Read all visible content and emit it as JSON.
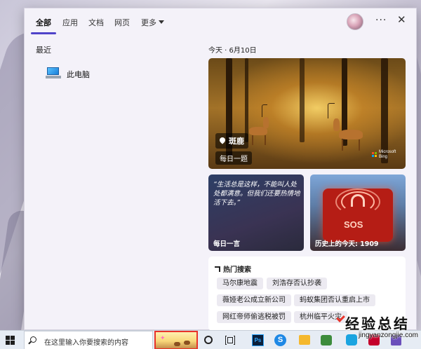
{
  "tabs": [
    {
      "label": "全部",
      "active": true
    },
    {
      "label": "应用",
      "active": false
    },
    {
      "label": "文档",
      "active": false
    },
    {
      "label": "网页",
      "active": false
    },
    {
      "label": "更多",
      "active": false
    }
  ],
  "header_icons": {
    "avatar": "user-avatar",
    "more": "···",
    "close": "✕"
  },
  "recent": {
    "title": "最近",
    "items": [
      {
        "label": "此电脑",
        "icon": "computer-icon"
      }
    ]
  },
  "today": {
    "date_label": "今天 · 6月10日",
    "feature": {
      "location": "斑鹿",
      "caption": "每日一题",
      "brand_line1": "Microsoft",
      "brand_line2": "Bing"
    },
    "quote": {
      "text": "“生活总是这样，不能叫人处处都满意。但我们还要热情地活下去。”",
      "label": "每日一言"
    },
    "history": {
      "sign_text": "SOS",
      "label": "历史上的今天: 1909"
    }
  },
  "hot_search": {
    "title": "热门搜索",
    "items": [
      "马尔康地震",
      "刘浩存否认抄袭",
      "薇娅老公成立新公司",
      "蚂蚁集团否认重启上市",
      "网红帝师偷逃税被罚",
      "杭州临平火灾"
    ]
  },
  "taskbar": {
    "search_placeholder": "在这里输入你要搜索的内容",
    "ps_label": "Ps",
    "browser_label": "S"
  },
  "watermark": {
    "title": "经验总结",
    "url": "jingyanzongjie.com"
  },
  "colors": {
    "accent": "#4f43c9",
    "highlight_border": "#e8332a",
    "taskbar": "#e6ecf4"
  }
}
